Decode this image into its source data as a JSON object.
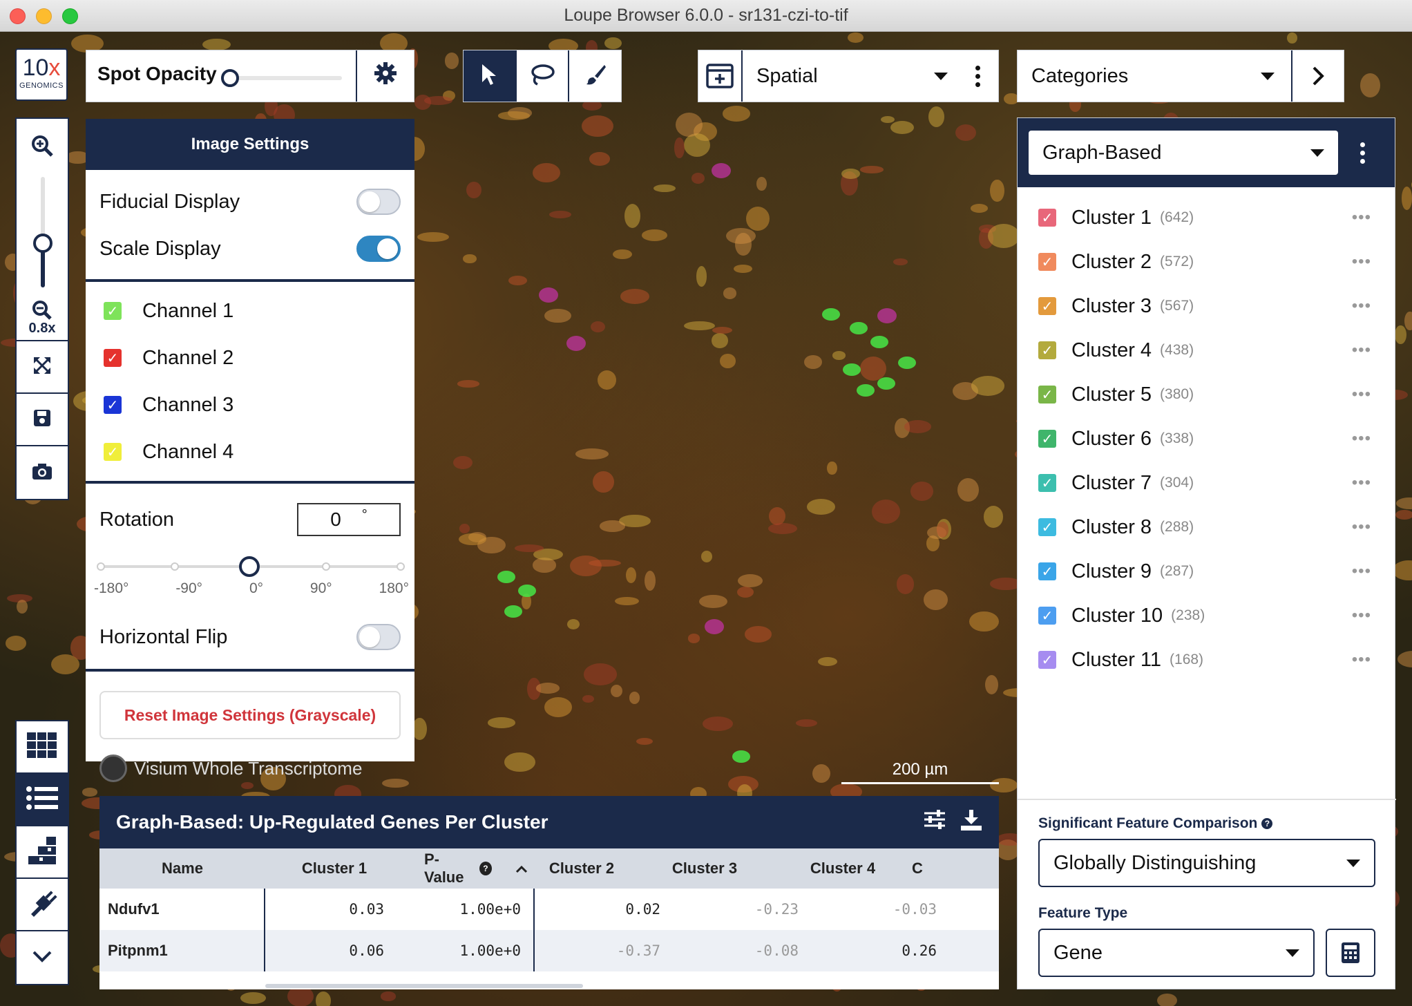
{
  "window": {
    "title": "Loupe Browser 6.0.0 - sr131-czi-to-tif"
  },
  "logo": {
    "line1_a": "10",
    "line1_b": "x",
    "line2": "GENOMICS"
  },
  "zoom": {
    "level": "0.8x",
    "slider_fraction": 0.4
  },
  "spot_opacity": {
    "label": "Spot Opacity",
    "value": 0.0
  },
  "image_settings": {
    "header": "Image Settings",
    "fiducial_label": "Fiducial Display",
    "fiducial_on": false,
    "scale_label": "Scale Display",
    "scale_on": true,
    "channels": [
      {
        "label": "Channel 1",
        "color": "#7ee35a"
      },
      {
        "label": "Channel 2",
        "color": "#e5322d"
      },
      {
        "label": "Channel 3",
        "color": "#1a35d6"
      },
      {
        "label": "Channel 4",
        "color": "#f0ee3a"
      }
    ],
    "rotation_label": "Rotation",
    "rotation_value": "0",
    "rotation_unit": "°",
    "rotation_ticks": [
      "-180°",
      "-90°",
      "0°",
      "90°",
      "180°"
    ],
    "hflip_label": "Horizontal Flip",
    "hflip_on": false,
    "reset_label": "Reset Image Settings (Grayscale)"
  },
  "view_selector": {
    "value": "Spatial"
  },
  "categories_selector": {
    "value": "Categories"
  },
  "cluster_panel": {
    "select_value": "Graph-Based",
    "clusters": [
      {
        "name": "Cluster 1",
        "count": "(642)",
        "color": "#e8677a"
      },
      {
        "name": "Cluster 2",
        "count": "(572)",
        "color": "#f08a5d"
      },
      {
        "name": "Cluster 3",
        "count": "(567)",
        "color": "#e39a3c"
      },
      {
        "name": "Cluster 4",
        "count": "(438)",
        "color": "#b3aa3d"
      },
      {
        "name": "Cluster 5",
        "count": "(380)",
        "color": "#7ab648"
      },
      {
        "name": "Cluster 6",
        "count": "(338)",
        "color": "#3fb56b"
      },
      {
        "name": "Cluster 7",
        "count": "(304)",
        "color": "#3cbfae"
      },
      {
        "name": "Cluster 8",
        "count": "(288)",
        "color": "#3dbbe0"
      },
      {
        "name": "Cluster 9",
        "count": "(287)",
        "color": "#3aa5e8"
      },
      {
        "name": "Cluster 10",
        "count": "(238)",
        "color": "#4d9ef0"
      },
      {
        "name": "Cluster 11",
        "count": "(168)",
        "color": "#a68cf0"
      }
    ],
    "more_glyph": "•••",
    "sig_label": "Significant Feature Comparison",
    "sig_value": "Globally Distinguishing",
    "feature_label": "Feature Type",
    "feature_value": "Gene"
  },
  "assay_label": "Visium Whole Transcriptome",
  "scale_bar": "200 µm",
  "gene_table": {
    "title": "Graph-Based: Up-Regulated Genes Per Cluster",
    "columns": [
      "Name",
      "Cluster 1",
      "P-Value",
      "Cluster 2",
      "Cluster 3",
      "Cluster 4",
      "C"
    ],
    "rows": [
      {
        "name": "Ndufv1",
        "c1": "0.03",
        "p": "1.00e+0",
        "c2": "0.02",
        "c3": "-0.23",
        "c4": "-0.03"
      },
      {
        "name": "Pitpnm1",
        "c1": "0.06",
        "p": "1.00e+0",
        "c2": "-0.37",
        "c3": "-0.08",
        "c4": "0.26"
      }
    ]
  }
}
